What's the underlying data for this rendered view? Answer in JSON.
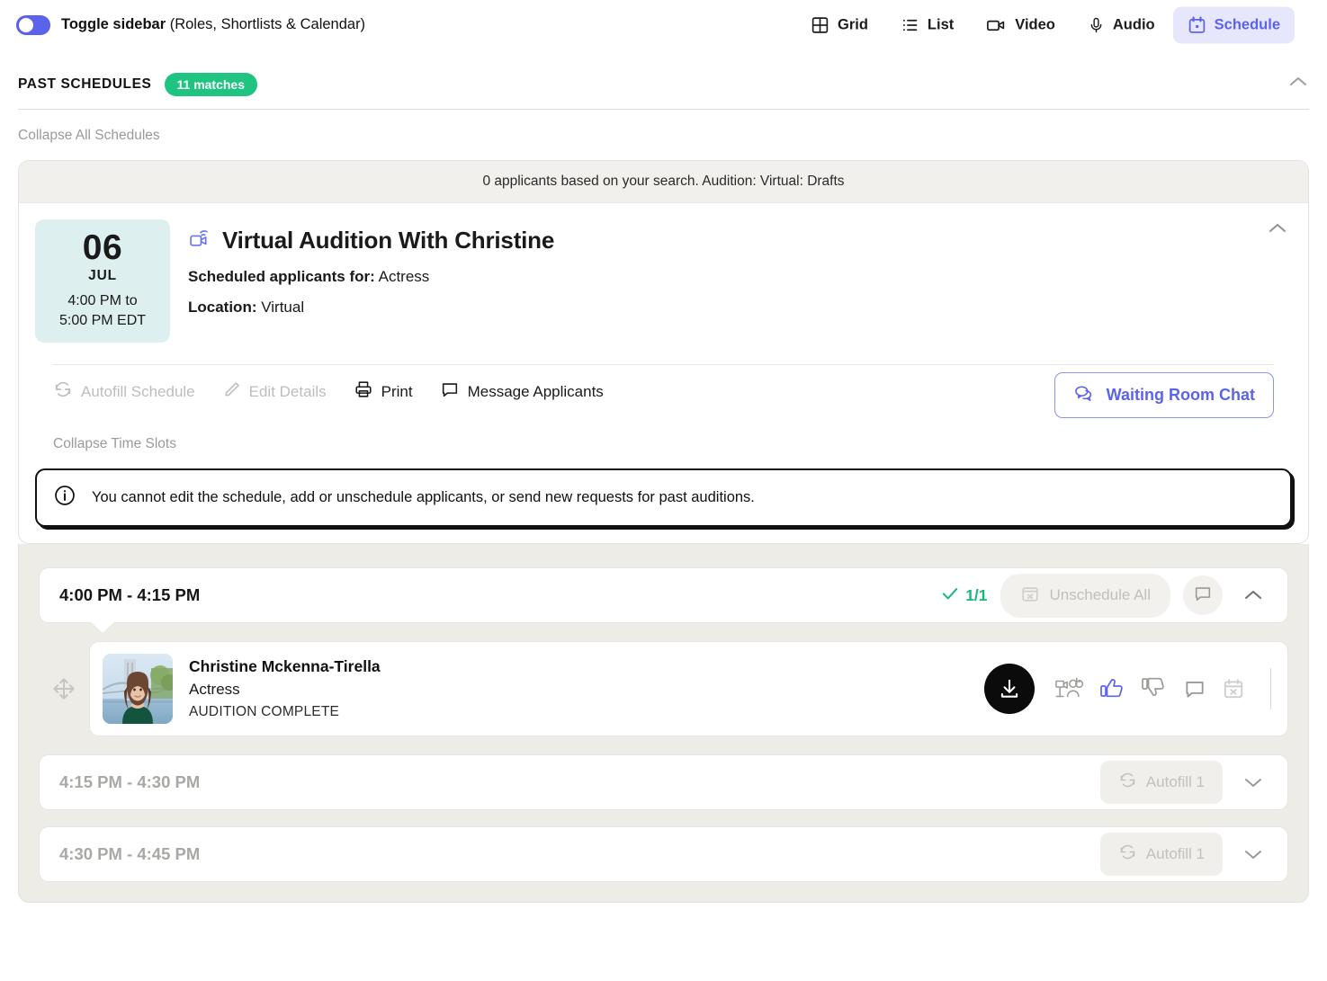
{
  "topbar": {
    "toggle_bold": "Toggle sidebar",
    "toggle_rest": " (Roles, Shortlists & Calendar)",
    "tabs": [
      {
        "label": "Grid",
        "icon": "grid-icon",
        "active": false
      },
      {
        "label": "List",
        "icon": "list-icon",
        "active": false
      },
      {
        "label": "Video",
        "icon": "video-icon",
        "active": false
      },
      {
        "label": "Audio",
        "icon": "microphone-icon",
        "active": false
      },
      {
        "label": "Schedule",
        "icon": "calendar-icon",
        "active": true
      }
    ]
  },
  "section": {
    "title": "PAST SCHEDULES",
    "match_pill": "11 matches",
    "collapse_all": "Collapse All Schedules"
  },
  "schedule": {
    "search_banner": "0 applicants based on your search. Audition: Virtual: Drafts",
    "date": {
      "day": "06",
      "month": "JUL",
      "time_line1": "4:00 PM to",
      "time_line2": "5:00 PM EDT"
    },
    "title": "Virtual Audition With Christine",
    "applicants_label": "Scheduled applicants for:",
    "applicants_value": "Actress",
    "location_label": "Location:",
    "location_value": "Virtual",
    "actions": [
      {
        "label": "Autofill Schedule",
        "icon": "refresh-icon",
        "disabled": true
      },
      {
        "label": "Edit Details",
        "icon": "pencil-icon",
        "disabled": true
      },
      {
        "label": "Print",
        "icon": "printer-icon",
        "disabled": false
      },
      {
        "label": "Message Applicants",
        "icon": "comment-icon",
        "disabled": false
      }
    ],
    "waiting_room_chat": "Waiting Room Chat",
    "collapse_slots": "Collapse Time Slots",
    "notice": "You cannot edit the schedule, add or unschedule applicants, or send new requests for past auditions."
  },
  "slots": [
    {
      "time": "4:00 PM - 4:15 PM",
      "expanded": true,
      "count": "1/1",
      "unschedule_label": "Unschedule All",
      "applicant": {
        "name": "Christine Mckenna-Tirella",
        "role": "Actress",
        "status": "AUDITION COMPLETE"
      }
    },
    {
      "time": "4:15 PM - 4:30 PM",
      "expanded": false,
      "autofill_label": "Autofill 1"
    },
    {
      "time": "4:30 PM - 4:45 PM",
      "expanded": false,
      "autofill_label": "Autofill 1"
    }
  ],
  "colors": {
    "accent": "#5b63ec",
    "accent_bg": "#e6e7fd",
    "green": "#1ec47f",
    "date_box": "#ddefee",
    "slots_bg": "#edece7",
    "banner_bg": "#f1f0ec"
  }
}
